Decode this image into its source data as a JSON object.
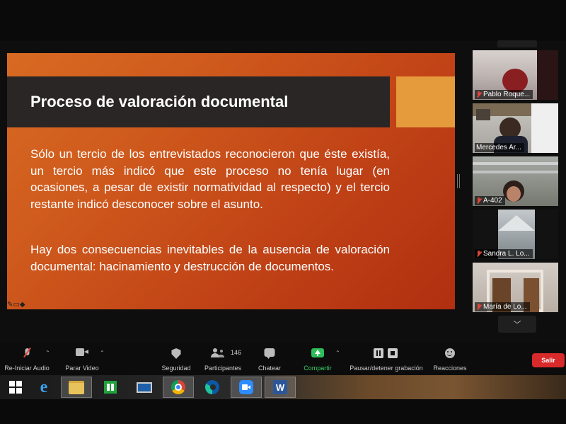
{
  "slide": {
    "title": "Proceso de valoración documental",
    "paragraph1": "Sólo un tercio de los entrevistados reconocieron que éste existía, un tercio más indicó que este proceso no tenía lugar (en ocasiones, a pesar de existir normatividad al respecto) y el tercio restante indicó desconocer sobre el asunto.",
    "paragraph2": "Hay dos consecuencias inevitables de la ausencia de valoración documental: hacinamiento y destrucción de documentos."
  },
  "participants": [
    {
      "name": "Pablo Roque...",
      "muted": true
    },
    {
      "name": "Mercedes Ar...",
      "muted": false
    },
    {
      "name": "A-402",
      "muted": true
    },
    {
      "name": "Sandra  L. Lo...",
      "muted": true
    },
    {
      "name": "María de Lo...",
      "muted": true
    }
  ],
  "toolbar": {
    "audio_label": "Re-Iniciar Audio",
    "video_label": "Parar Video",
    "security_label": "Seguridad",
    "participants_label": "Participantes",
    "participants_count": "146",
    "chat_label": "Chatear",
    "share_label": "Compartir",
    "record_label": "Pausar/detener grabación",
    "reactions_label": "Reacciones",
    "leave_label": "Salir"
  },
  "colors": {
    "slide_orange": "#cf5a1d",
    "title_bar": "#2a2625",
    "accent": "#e59a3b",
    "share_green": "#2ebd5a",
    "leave_red": "#d82a2a"
  },
  "taskbar_icons": [
    "windows-start-icon",
    "internet-explorer-icon",
    "file-explorer-icon",
    "store-icon",
    "remote-desktop-icon",
    "chrome-icon",
    "edge-icon",
    "zoom-icon",
    "word-icon"
  ]
}
